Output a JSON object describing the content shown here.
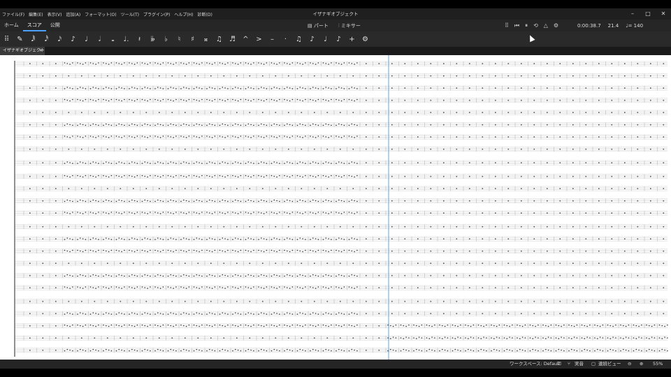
{
  "menu": [
    "ファイル(F)",
    "編集(E)",
    "表示(V)",
    "追加(A)",
    "フォーマット(O)",
    "ツール(T)",
    "プラグイン(P)",
    "ヘルプ(H)",
    "診断(D)"
  ],
  "window": {
    "title": "イザナギオブジェクト",
    "minimize": "–",
    "maximize": "□",
    "close": "✕"
  },
  "tabs": [
    "ホーム",
    "スコア",
    "公開"
  ],
  "active_tab": "スコア",
  "center": {
    "parts_label": "パート",
    "mixer_label": "ミキサー"
  },
  "playback": {
    "time": "0:00:38.7",
    "position": "21.4",
    "tempo": "♩= 140"
  },
  "toolbar_glyphs": [
    "⠿",
    "✎",
    "𝅘𝅥𝅱",
    "𝅘𝅥𝅰",
    "𝅘𝅥𝅯",
    "♪",
    "♩",
    "𝅗𝅥",
    "𝅝",
    "♩.",
    "𝄽",
    "𝄫",
    "♭",
    "♮",
    "♯",
    "𝄪",
    "♫",
    "♬",
    "^",
    ">",
    "–",
    "·",
    "♫",
    "♪",
    "♩",
    "♪",
    "+",
    "⚙"
  ],
  "doc_tab": {
    "label": "イザナギオブジェクト",
    "close": "✕"
  },
  "status": {
    "workspace": "ワークスペース: Default",
    "concert_pitch": "実音",
    "view_mode": "連続ビュー",
    "zoom": "55%"
  },
  "colors": {
    "accent": "#4aa0ff",
    "playhead": "#3b8fd9"
  }
}
